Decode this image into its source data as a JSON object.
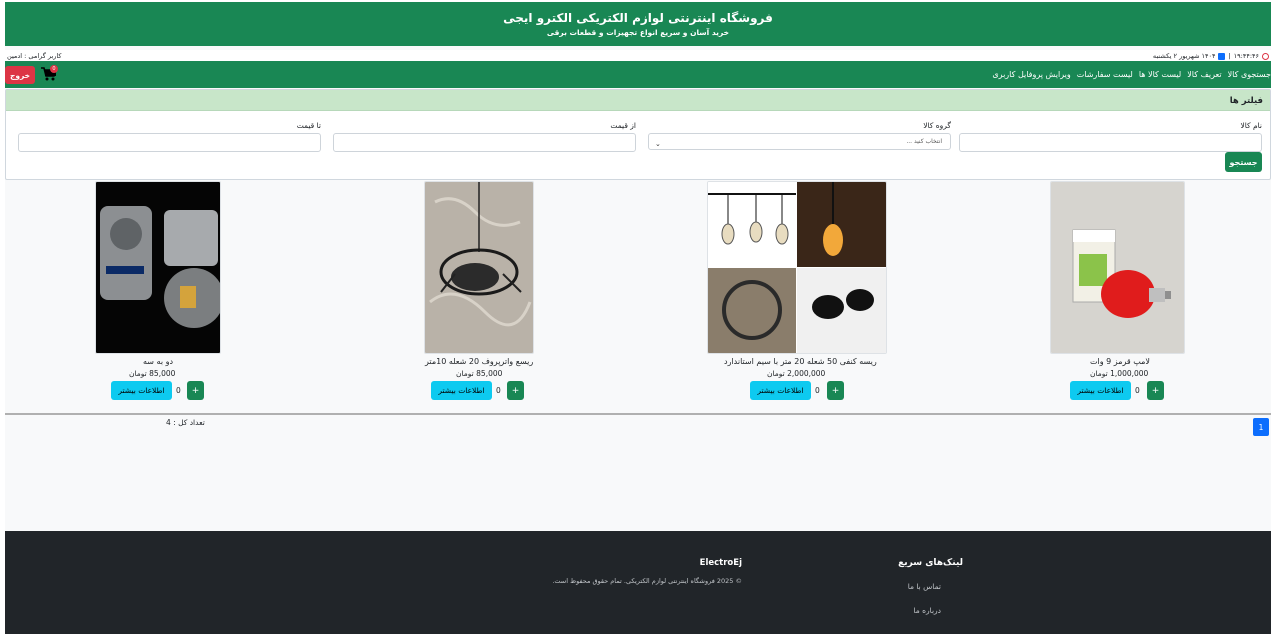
{
  "banner": {
    "title": "فروشگاه اینترنتی لوازم الکتریکی الکترو ایجی",
    "subtitle": "خرید آسان و سریع انواع تجهیزات و قطعات برقی"
  },
  "infoline": {
    "time": "۱۹:۴۴:۴۶",
    "date": "۱۴۰۴ شهریور ۲ یکشنبه",
    "user": "کاربر گرامی : ادمین"
  },
  "nav": {
    "items": [
      "جستجوی کالا",
      "تعریف کالا",
      "لیست کالا ها",
      "لیست سفارشات",
      "ویرایش پروفایل کاربری"
    ],
    "logout": "خروج",
    "cart_count": "0"
  },
  "filters": {
    "header": "فیلتر ها",
    "name_label": "نام کالا",
    "group_label": "گروه کالا",
    "group_selected": "انتخاب کنید ...",
    "from_price_label": "از قیمت",
    "to_price_label": "تا قیمت",
    "search_button": "جستجو"
  },
  "products": [
    {
      "name": "لامپ قرمز 9 وات",
      "price": "1,000,000 تومان",
      "qty": "0",
      "info_label": "اطلاعات بیشتر",
      "add_label": "+"
    },
    {
      "name": "ریسه کنفی 50 شعله 20 متر با سیم استاندارد",
      "price": "2,000,000 تومان",
      "qty": "0",
      "info_label": "اطلاعات بیشتر",
      "add_label": "+"
    },
    {
      "name": "ریسع واترپروف 20 شعله 10متر",
      "price": "85,000 تومان",
      "qty": "0",
      "info_label": "اطلاعات بیشتر",
      "add_label": "+"
    },
    {
      "name": "دو به سه",
      "price": "85,000 تومان",
      "qty": "0",
      "info_label": "اطلاعات بیشتر",
      "add_label": "+"
    }
  ],
  "pagination": {
    "current": "1"
  },
  "total": "تعداد کل : 4",
  "footer": {
    "quick_links_title": "لینک‌های سریع",
    "links": [
      "تماس با ما",
      "درباره ما"
    ],
    "brand": "ElectroEj",
    "copyright": "© 2025 فروشگاه اینترنتی لوازم الکتریکی. تمام حقوق محفوظ است."
  },
  "colors": {
    "primary_green": "#198754",
    "danger_red": "#dc3545",
    "info_cyan": "#0dcaf0",
    "pager_blue": "#0d6efd",
    "filter_header": "#c8e6c9",
    "footer_bg": "#212529"
  }
}
